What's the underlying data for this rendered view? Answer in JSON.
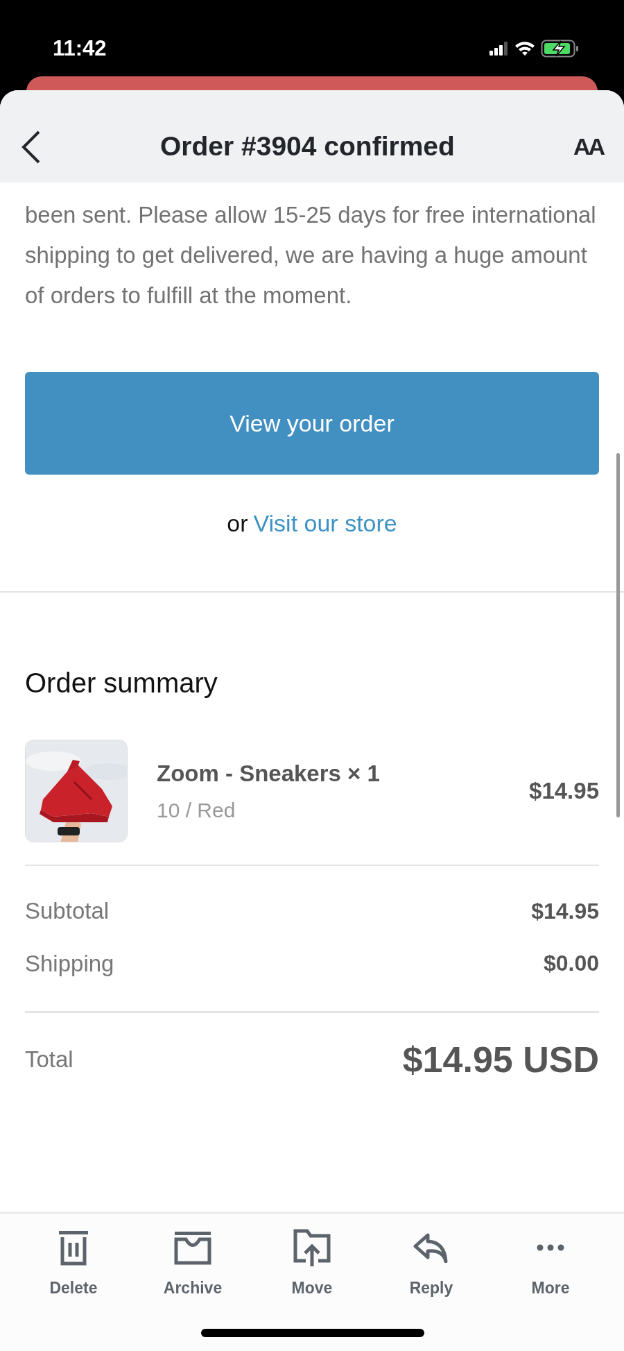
{
  "status_bar": {
    "time": "11:42"
  },
  "header": {
    "title": "Order #3904 confirmed",
    "text_size_button": "AA"
  },
  "message": {
    "paragraph": "been sent. Please allow 15-25 days for free international shipping to get delivered, we are having a huge amount of orders to fulfill at the moment.",
    "button": "View your order",
    "or_text": "or",
    "store_link": "Visit our store"
  },
  "order_summary": {
    "title": "Order summary",
    "items": [
      {
        "kind": "picture",
        "name": "Zoom - Sneakers × 1",
        "variant": "10 / Red",
        "price": "$14.95"
      }
    ],
    "lines": [
      {
        "label": "Subtotal",
        "value": "$14.95"
      },
      {
        "label": "Shipping",
        "value": "$0.00"
      }
    ],
    "total": {
      "label": "Total",
      "value": "$14.95 USD"
    }
  },
  "toolbar": [
    {
      "kind": "delete",
      "label": "Delete"
    },
    {
      "kind": "archive",
      "label": "Archive"
    },
    {
      "kind": "move",
      "label": "Move"
    },
    {
      "kind": "reply",
      "label": "Reply"
    },
    {
      "kind": "more",
      "label": "More"
    }
  ]
}
